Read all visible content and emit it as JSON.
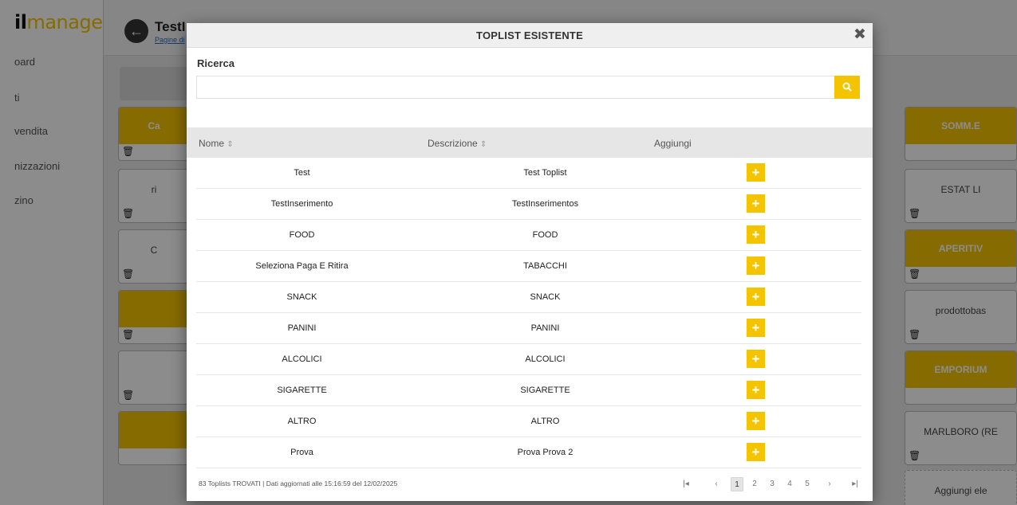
{
  "background": {
    "logo_bold": "il",
    "logo_rest": "manager",
    "sidebar_items": [
      "oard",
      "ti",
      "vendita",
      "nizzazioni",
      "zino"
    ],
    "page_title": "TestI",
    "page_link": "Pagine di",
    "tiles": [
      {
        "text": "Ca"
      },
      {
        "text": "ri"
      },
      {
        "text": "C"
      },
      {
        "text": "SOMM.E"
      },
      {
        "text": "ESTAT LI"
      },
      {
        "text": "APERITIV"
      },
      {
        "text": "prodottobas"
      },
      {
        "text": "EMPORIUM"
      },
      {
        "text": "MARLBORO (RE"
      },
      {
        "text": "Aggiungi ele"
      }
    ]
  },
  "modal": {
    "title": "TOPLIST ESISTENTE",
    "search": {
      "label": "Ricerca",
      "placeholder": "",
      "value": ""
    },
    "columns": {
      "name": "Nome",
      "description": "Descrizione",
      "add": "Aggiungi"
    },
    "rows": [
      {
        "name": "Test",
        "description": "Test Toplist"
      },
      {
        "name": "TestInserimento",
        "description": "TestInserimentos"
      },
      {
        "name": "FOOD",
        "description": "FOOD"
      },
      {
        "name": "Seleziona Paga E Ritira",
        "description": "TABACCHI"
      },
      {
        "name": "SNACK",
        "description": "SNACK"
      },
      {
        "name": "PANINI",
        "description": "PANINI"
      },
      {
        "name": "ALCOLICI",
        "description": "ALCOLICI"
      },
      {
        "name": "SIGARETTE",
        "description": "SIGARETTE"
      },
      {
        "name": "ALTRO",
        "description": "ALTRO"
      },
      {
        "name": "Prova",
        "description": "Prova Prova 2"
      }
    ],
    "footer_info": "83 Toplists TROVATI | Dati aggiornati alle 15:16:59 del 12/02/2025",
    "pager": {
      "first": "|◂",
      "prev": "‹",
      "pages": [
        "1",
        "2",
        "3",
        "4",
        "5"
      ],
      "active": "1",
      "next": "›",
      "last": "▸|"
    }
  },
  "colors": {
    "accent": "#f5c400",
    "header_bg": "#efefef",
    "table_head_bg": "#e6e6e6"
  }
}
